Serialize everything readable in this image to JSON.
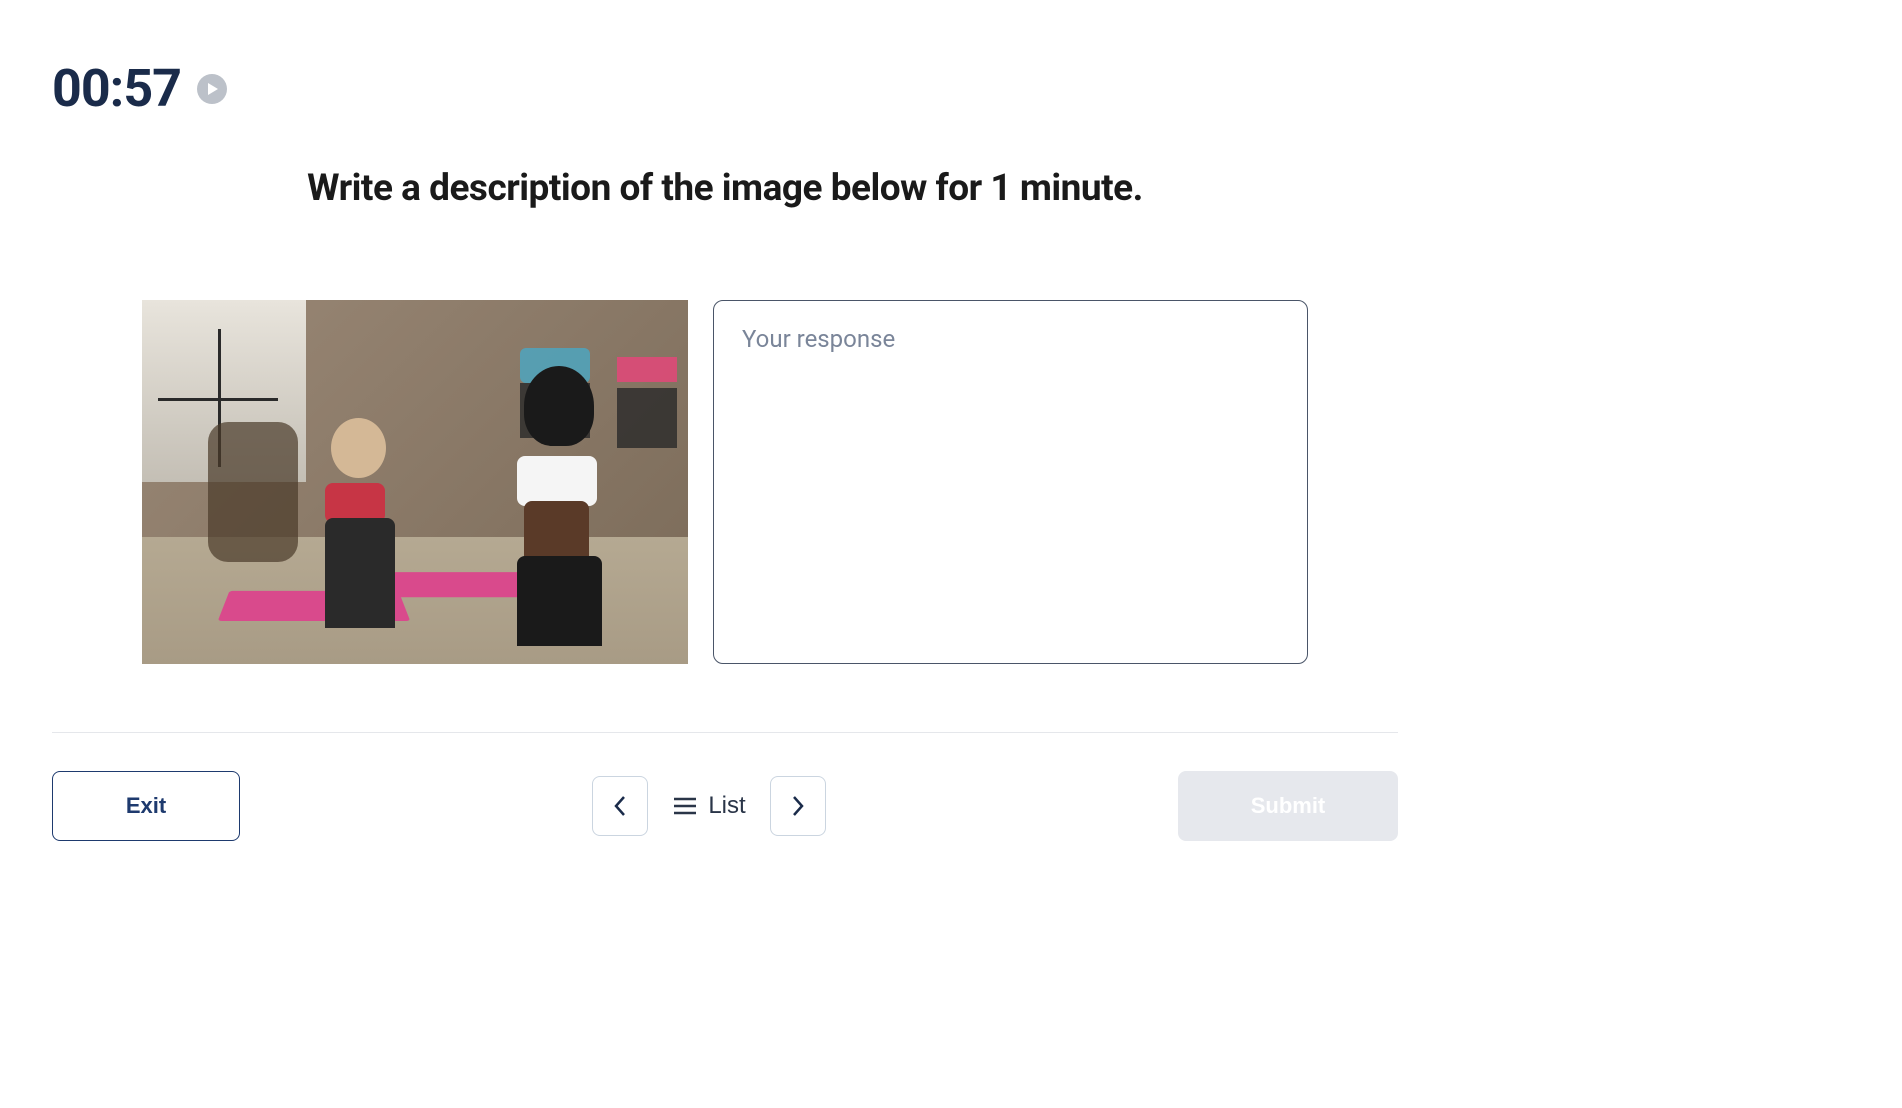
{
  "timer": {
    "value": "00:57"
  },
  "prompt": {
    "text": "Write a description of the image below for 1 minute."
  },
  "response": {
    "placeholder": "Your response",
    "value": ""
  },
  "footer": {
    "exit_label": "Exit",
    "list_label": "List",
    "submit_label": "Submit"
  },
  "image": {
    "description": "Women in a fitness/yoga class on pink mats in a studio with brick walls and large windows"
  }
}
